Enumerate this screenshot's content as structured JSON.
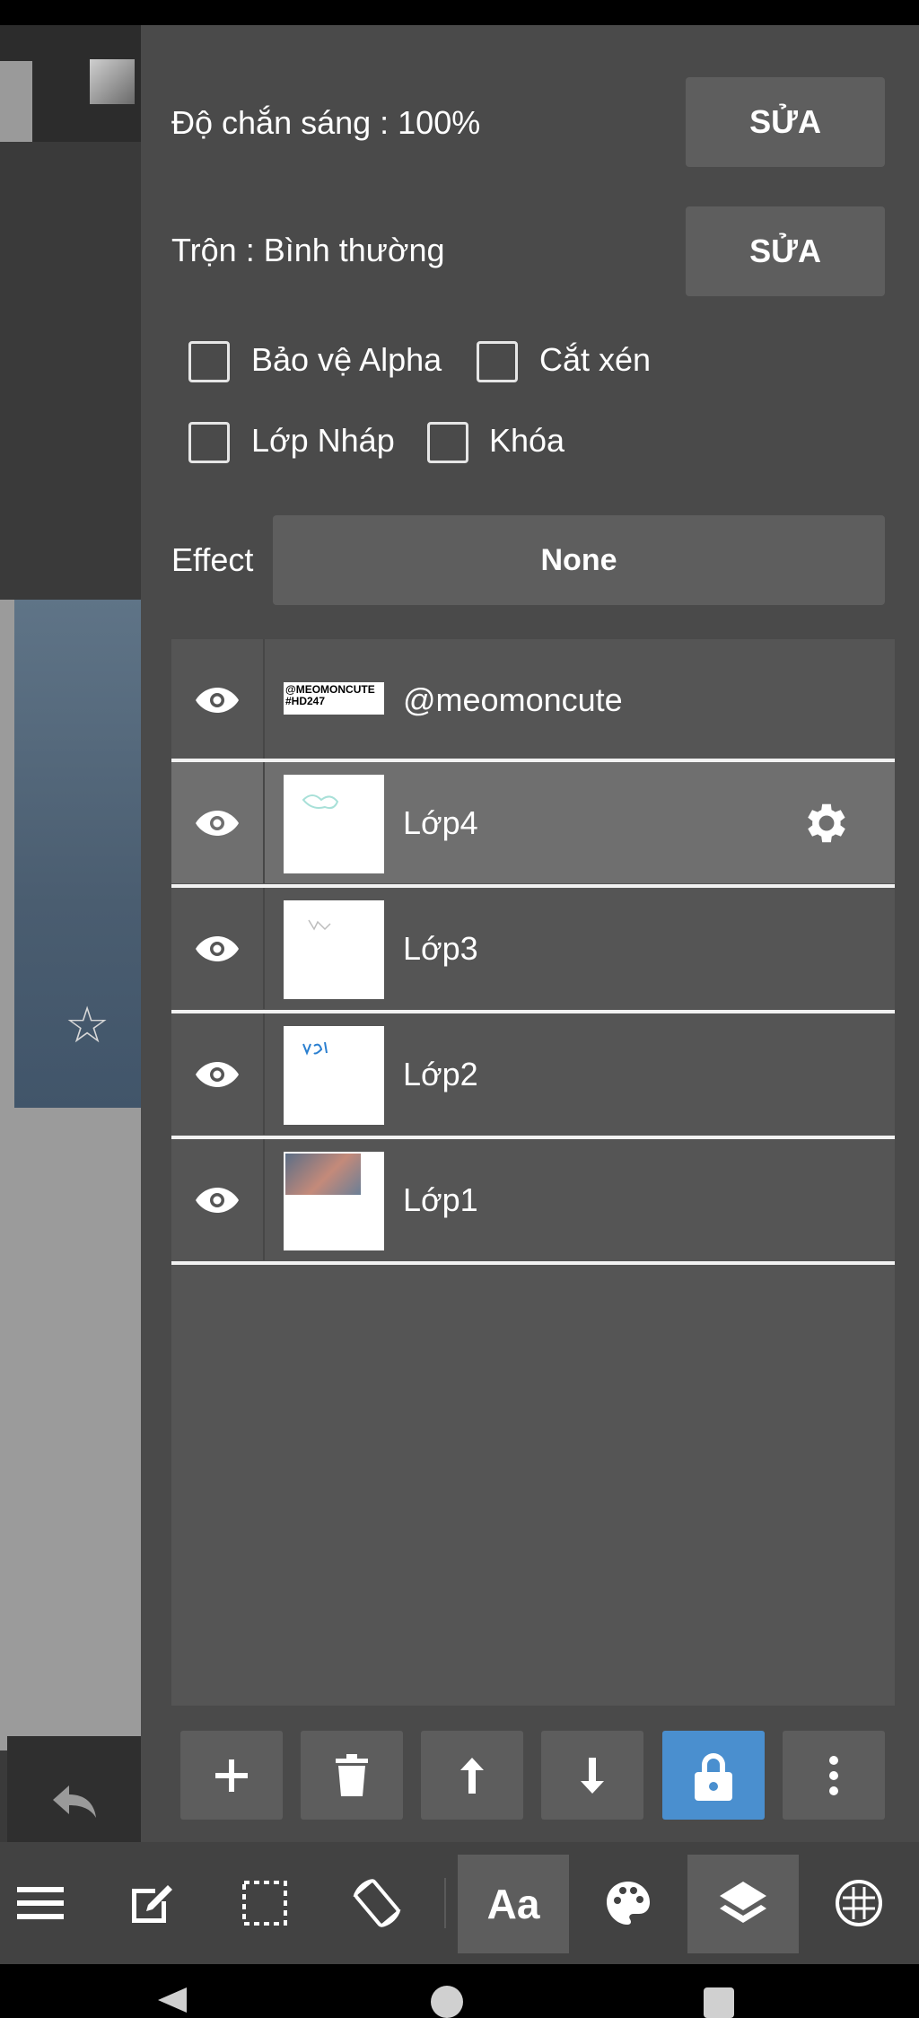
{
  "panel": {
    "opacity_label": "Độ chắn sáng : 100%",
    "opacity_edit": "SỬA",
    "blend_label": "Trộn : Bình thường",
    "blend_edit": "SỬA",
    "checkboxes": {
      "protect_alpha": "Bảo vệ Alpha",
      "clipping": "Cắt xén",
      "draft_layer": "Lớp Nháp",
      "lock": "Khóa"
    },
    "effect_label": "Effect",
    "effect_value": "None"
  },
  "layers": [
    {
      "name": "@meomoncute",
      "thumb_text": "@MEOMONCUTE #HD247",
      "selected": false
    },
    {
      "name": "Lớp4",
      "selected": true
    },
    {
      "name": "Lớp3",
      "selected": false
    },
    {
      "name": "Lớp2",
      "selected": false
    },
    {
      "name": "Lớp1",
      "selected": false
    }
  ],
  "layer_toolbar": [
    "add-icon",
    "trash-icon",
    "arrow-up-icon",
    "arrow-down-icon",
    "lock-icon",
    "more-vertical-icon"
  ],
  "bottom_bar": {
    "items": [
      "menu-icon",
      "edit-icon",
      "selection-icon",
      "rotate-icon",
      "text-tool",
      "palette-icon",
      "layers-icon",
      "material-icon"
    ],
    "text_tool_label": "Aa"
  },
  "colors": {
    "panel_bg": "#4a4a4a",
    "lock_active": "#4a8fcf",
    "bottom_bar": "#424242"
  }
}
